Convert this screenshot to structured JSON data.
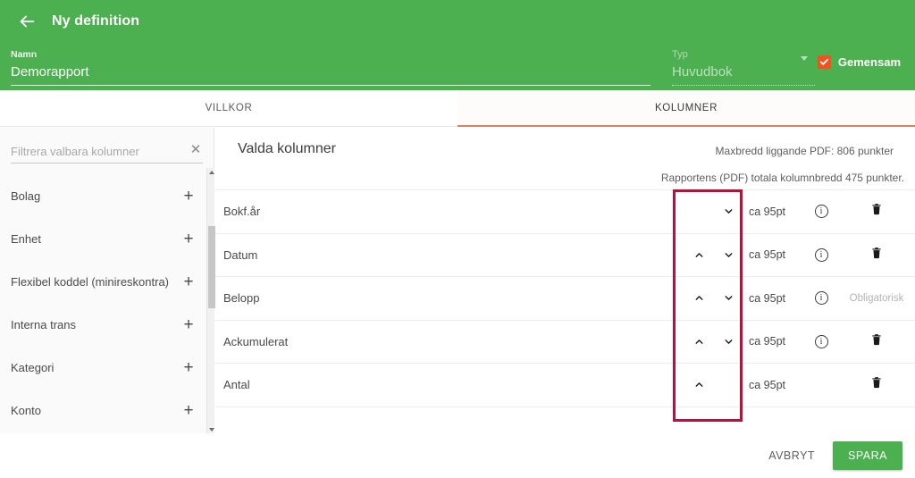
{
  "header": {
    "back_icon": "arrow-left-icon",
    "title": "Ny definition",
    "name_field": {
      "label": "Namn",
      "value": "Demorapport",
      "placeholder": "Namn"
    },
    "type_field": {
      "label": "Typ",
      "value": "Huvudbok",
      "caret_icon": "chevron-down-icon"
    },
    "shared": {
      "label": "Gemensam",
      "checked": true,
      "check_icon": "check-icon",
      "color": "#f4511e"
    },
    "bg_color": "#4caf50"
  },
  "tabs": [
    {
      "label": "VILLKOR",
      "active": false
    },
    {
      "label": "KOLUMNER",
      "active": true
    }
  ],
  "tab_accent_color": "#e0805f",
  "sidebar": {
    "filter": {
      "placeholder": "Filtrera valbara kolumner",
      "value": "",
      "clear_icon": "close-icon"
    },
    "items": [
      {
        "label": "Bolag",
        "add_icon": "plus-icon"
      },
      {
        "label": "Enhet",
        "add_icon": "plus-icon"
      },
      {
        "label": "Flexibel koddel (minireskontra)",
        "add_icon": "plus-icon"
      },
      {
        "label": "Interna trans",
        "add_icon": "plus-icon"
      },
      {
        "label": "Kategori",
        "add_icon": "plus-icon"
      },
      {
        "label": "Konto",
        "add_icon": "plus-icon"
      }
    ],
    "scrollbar": {
      "up_icon": "scroll-up-arrow-icon",
      "down_icon": "scroll-down-arrow-icon"
    }
  },
  "main": {
    "title": "Valda kolumner",
    "note_max_width": "Maxbredd liggande PDF: 806 punkter",
    "note_total_width": "Rapportens (PDF) totala kolumnbredd 475 punkter.",
    "rows": [
      {
        "name": "Bokf.år",
        "up": false,
        "down": true,
        "width": "ca 95pt",
        "info": true,
        "action": "trash",
        "action_label": ""
      },
      {
        "name": "Datum",
        "up": true,
        "down": true,
        "width": "ca 95pt",
        "info": true,
        "action": "trash",
        "action_label": ""
      },
      {
        "name": "Belopp",
        "up": true,
        "down": true,
        "width": "ca 95pt",
        "info": true,
        "action": "label",
        "action_label": "Obligatorisk"
      },
      {
        "name": "Ackumulerat",
        "up": true,
        "down": true,
        "width": "ca 95pt",
        "info": true,
        "action": "trash",
        "action_label": ""
      },
      {
        "name": "Antal",
        "up": true,
        "down": false,
        "width": "ca 95pt",
        "info": false,
        "action": "trash",
        "action_label": ""
      }
    ]
  },
  "annotation": {
    "color": "#b8123c"
  },
  "footer": {
    "cancel_label": "AVBRYT",
    "save_label": "SPARA",
    "save_color": "#4caf50"
  }
}
